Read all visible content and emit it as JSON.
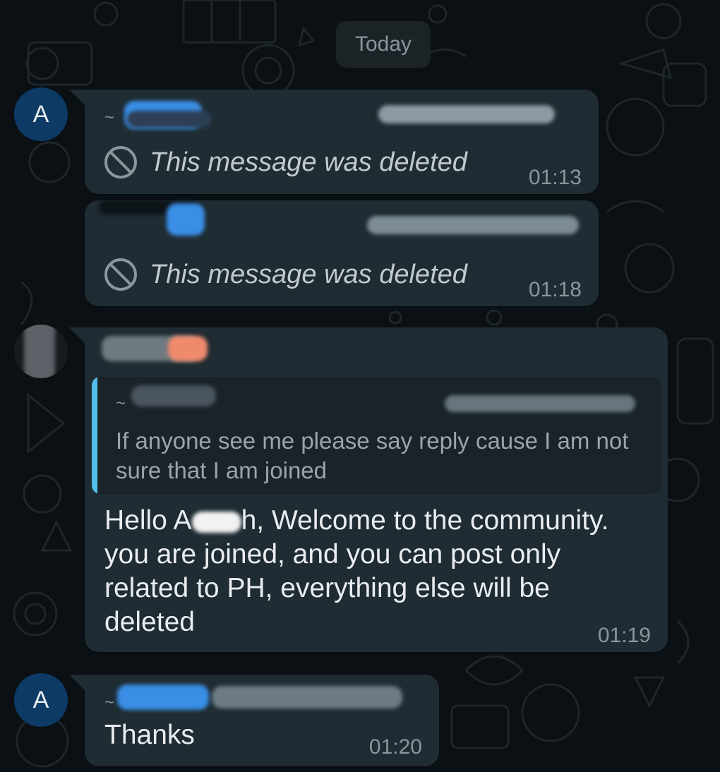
{
  "date_separator": "Today",
  "messages": [
    {
      "avatar_letter": "A",
      "prefix": "~",
      "deleted_text": "This message was deleted",
      "time": "01:13"
    },
    {
      "deleted_text": "This message was deleted",
      "time": "01:18"
    },
    {
      "quote": {
        "prefix": "~",
        "text": "If anyone see me please say reply cause I am not sure that I am joined"
      },
      "text_lines": [
        "Hello A",
        "h, Welcome to the community.",
        "you are joined, and you can post only",
        "related to PH, everything else will be",
        "deleted"
      ],
      "time": "01:19"
    },
    {
      "avatar_letter": "A",
      "prefix": "~",
      "text": "Thanks",
      "time": "01:20"
    }
  ],
  "colors": {
    "background": "#0b1014",
    "bubble": "#1f2c33",
    "avatar": "#0d3b66",
    "quote_bar": "#53bdeb",
    "muted_text": "#8a969d"
  },
  "icons": [
    "ban-icon"
  ]
}
